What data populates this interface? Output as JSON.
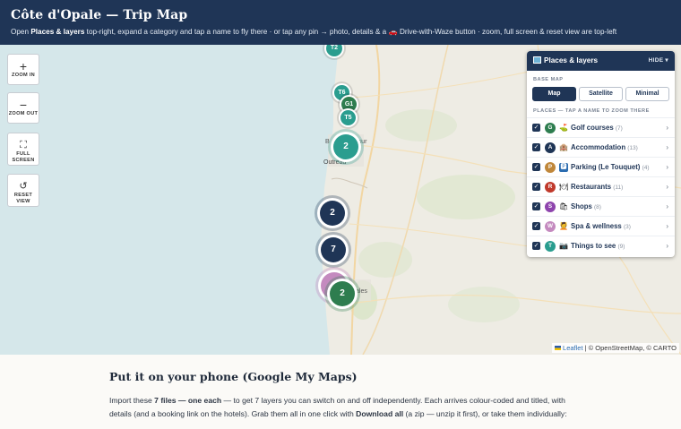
{
  "header": {
    "title": "Côte d'Opale — Trip Map",
    "sub_open": "Open ",
    "sub_bold": "Places & layers",
    "sub_rest": " top-right, expand a category and tap a name to fly there · or tap any pin → photo, details & a 🚗 Drive-with-Waze button · zoom, full screen & reset view are top-left"
  },
  "controls": {
    "zoom_in": {
      "glyph": "+",
      "label": "ZOOM IN"
    },
    "zoom_out": {
      "glyph": "−",
      "label": "ZOOM OUT"
    },
    "full_screen": {
      "glyph": "⛶",
      "label1": "FULL",
      "label2": "SCREEN"
    },
    "reset_view": {
      "glyph": "↺",
      "label1": "RESET",
      "label2": "VIEW"
    }
  },
  "map_labels": {
    "town1": "Outreau",
    "town1_frag": "B",
    "town1_frag2": "sur",
    "town2_frag": "ales"
  },
  "pins": [
    {
      "label": "T2",
      "color": "#2a9d8f"
    },
    {
      "label": "T6",
      "color": "#2a9d8f"
    },
    {
      "label": "G1",
      "color": "#2e7d4f"
    },
    {
      "label": "T5",
      "color": "#2a9d8f"
    },
    {
      "label": "2",
      "color": "#2a9d8f"
    },
    {
      "label": "2",
      "color": "#1f3556"
    },
    {
      "label": "7",
      "color": "#1f3556"
    },
    {
      "label": "2",
      "color": "#2e7d4f"
    }
  ],
  "panel": {
    "title": "Places & layers",
    "hide": "HIDE ▾",
    "base_map_label": "BASE MAP",
    "base_maps": [
      "Map",
      "Satellite",
      "Minimal"
    ],
    "places_label": "PLACES — TAP A NAME TO ZOOM THERE",
    "categories": [
      {
        "letter": "G",
        "color": "#2e7d4f",
        "emoji": "⛳",
        "name": "Golf courses",
        "count": "(7)"
      },
      {
        "letter": "A",
        "color": "#1f3556",
        "emoji": "🏨",
        "name": "Accommodation",
        "count": "(13)"
      },
      {
        "letter": "P",
        "color": "#c0873a",
        "emoji": "🅿",
        "name": "Parking (Le Touquet)",
        "count": "(4)"
      },
      {
        "letter": "R",
        "color": "#c0392b",
        "emoji": "🍽",
        "name": "Restaurants",
        "count": "(11)"
      },
      {
        "letter": "S",
        "color": "#8e44ad",
        "emoji": "🛍",
        "name": "Shops",
        "count": "(8)"
      },
      {
        "letter": "W",
        "color": "#c48abf",
        "emoji": "💆",
        "name": "Spa & wellness",
        "count": "(3)"
      },
      {
        "letter": "T",
        "color": "#2a9d8f",
        "emoji": "📷",
        "name": "Things to see",
        "count": "(9)"
      }
    ]
  },
  "attribution": {
    "leaflet": "Leaflet",
    "rest": " | © OpenStreetMap, © CARTO"
  },
  "lower": {
    "heading": "Put it on your phone (Google My Maps)",
    "p1": "Import these ",
    "p1_bold": "7 files — one each",
    "p1_rest": " — to get 7 layers you can switch on and off independently. Each arrives colour-coded and titled, with details (and a booking link on the hotels). Grab them all in one click with ",
    "p1_bold2": "Download all",
    "p1_end": " (a zip — unzip it first), or take them individually:"
  }
}
